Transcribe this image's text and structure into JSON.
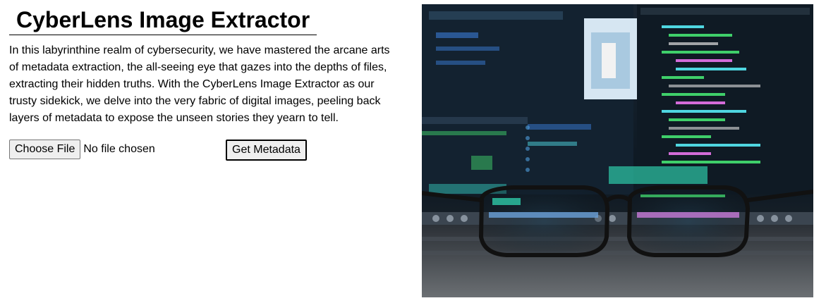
{
  "page": {
    "title": "CyberLens Image Extractor",
    "description": "In this labyrinthine realm of cybersecurity, we have mastered the arcane arts of metadata extraction, the all-seeing eye that gazes into the depths of files, extracting their hidden truths. With the CyberLens Image Extractor as our trusty sidekick, we delve into the very fabric of digital images, peeling back layers of metadata to expose the unseen stories they yearn to tell."
  },
  "form": {
    "choose_file_label": "Choose File",
    "file_status": "No file chosen",
    "submit_label": "Get Metadata"
  },
  "hero_image": {
    "icon": "monitor-code-glasses-photo"
  },
  "colors": {
    "code_green": "#3fcf6a",
    "code_cyan": "#4fd6e0",
    "code_blue": "#3a7bd5",
    "screen_dark": "#0b1520"
  }
}
